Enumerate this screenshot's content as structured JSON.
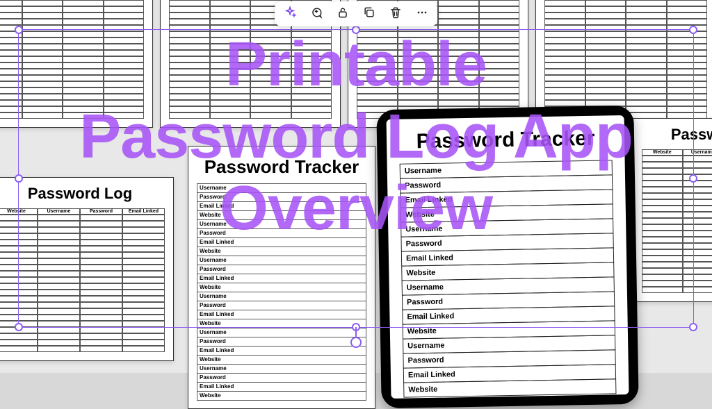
{
  "headline": {
    "line1": "Printable",
    "line2": "Password Log App",
    "line3": "Overview"
  },
  "toolbar": {
    "ai_magic": "ai-magic",
    "comment": "comment",
    "lock": "lock",
    "duplicate": "duplicate",
    "delete": "delete",
    "more": "more"
  },
  "mockup": {
    "password_log_title": "Password Log",
    "password_tracker_title": "Password Tracker",
    "log_columns": [
      "Website",
      "Username",
      "Password",
      "Email Linked"
    ],
    "tracker_fields": [
      "Username",
      "Password",
      "Email Linked",
      "Website"
    ]
  },
  "colors": {
    "accent": "#a855f7",
    "selection": "#8b5cf6"
  }
}
